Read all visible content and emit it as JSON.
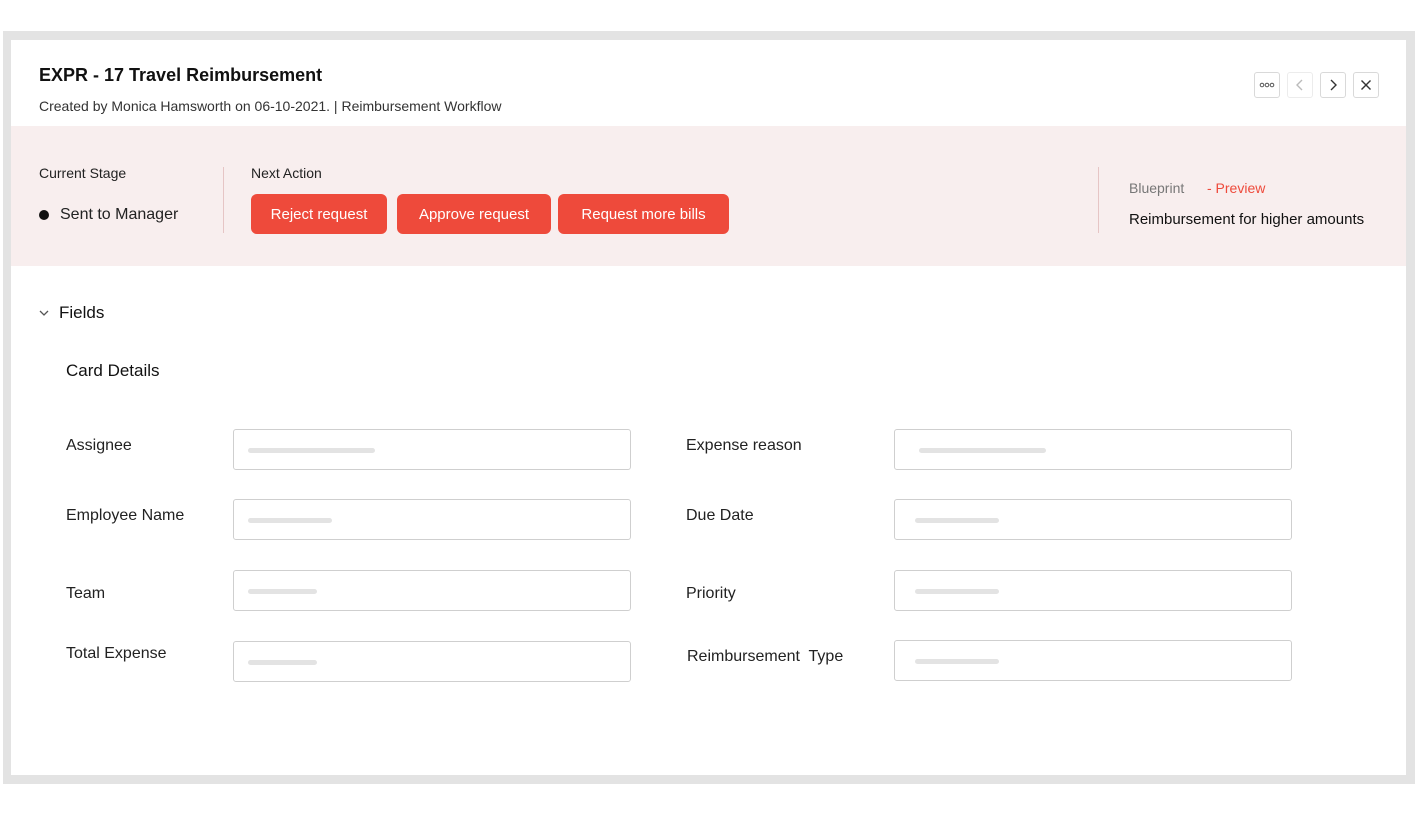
{
  "record": {
    "title": "EXPR - 17 Travel Reimbursement",
    "subtitle": "Created by Monica Hamsworth on 06-10-2021. | Reimbursement Workflow"
  },
  "toolbar": {
    "more_icon": "more-horizontal-icon",
    "prev_icon": "chevron-left-icon",
    "next_icon": "chevron-right-icon",
    "close_icon": "close-icon"
  },
  "stage": {
    "current_stage_label": "Current Stage",
    "current_stage_value": "Sent to Manager",
    "next_action_label": "Next Action",
    "actions": [
      "Reject request",
      "Approve request",
      "Request more bills"
    ]
  },
  "blueprint": {
    "label": "Blueprint",
    "preview": "- Preview",
    "description": "Reimbursement for higher amounts"
  },
  "fields_section": {
    "label": "Fields",
    "card_title": "Card Details",
    "fields": [
      {
        "label": "Assignee",
        "value": ""
      },
      {
        "label": "Expense reason",
        "value": ""
      },
      {
        "label": "Employee Name",
        "value": ""
      },
      {
        "label": "Due Date",
        "value": ""
      },
      {
        "label": "Team",
        "value": ""
      },
      {
        "label": "Priority",
        "value": ""
      },
      {
        "label": "Total Expense",
        "value": ""
      },
      {
        "label": "Reimbursement  Type",
        "value": ""
      }
    ]
  },
  "colors": {
    "accent": "#ee4a3b",
    "stage_bar_bg": "#f8eeee",
    "frame_border": "#e3e3e3"
  }
}
